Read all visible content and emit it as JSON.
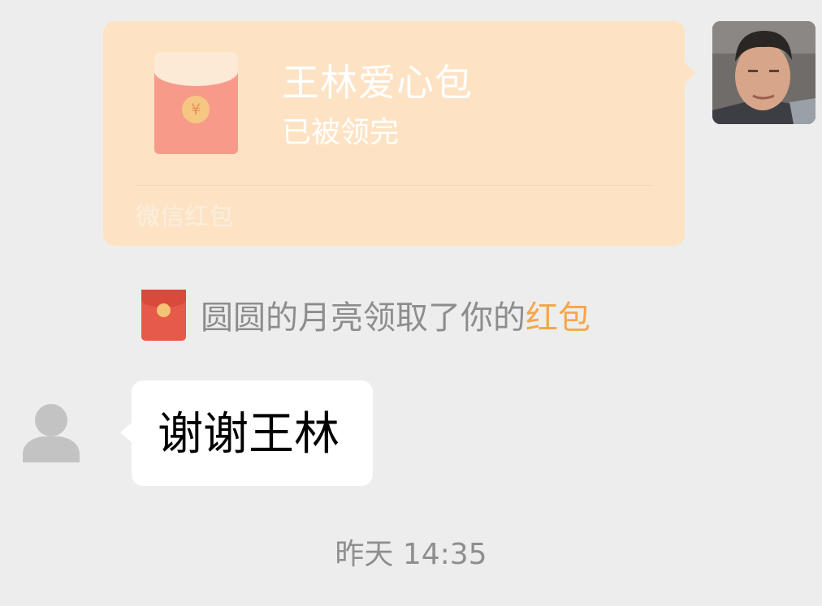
{
  "messages": {
    "red_packet": {
      "title": "王林爱心包",
      "status": "已被领完",
      "footer": "微信红包",
      "currency_symbol": "¥"
    },
    "notice": {
      "text": "圆圆的月亮领取了你的",
      "link": "红包"
    },
    "incoming": {
      "text": "谢谢王林"
    },
    "timestamp": "昨天 14:35"
  },
  "icons": {
    "right_avatar": "user-photo",
    "left_avatar": "default-person-avatar",
    "envelope": "red-envelope-icon"
  },
  "colors": {
    "background": "#ededed",
    "red_packet_bubble": "#fde3c4",
    "link": "#f3a74b",
    "notice_text": "#8d8d8d"
  }
}
